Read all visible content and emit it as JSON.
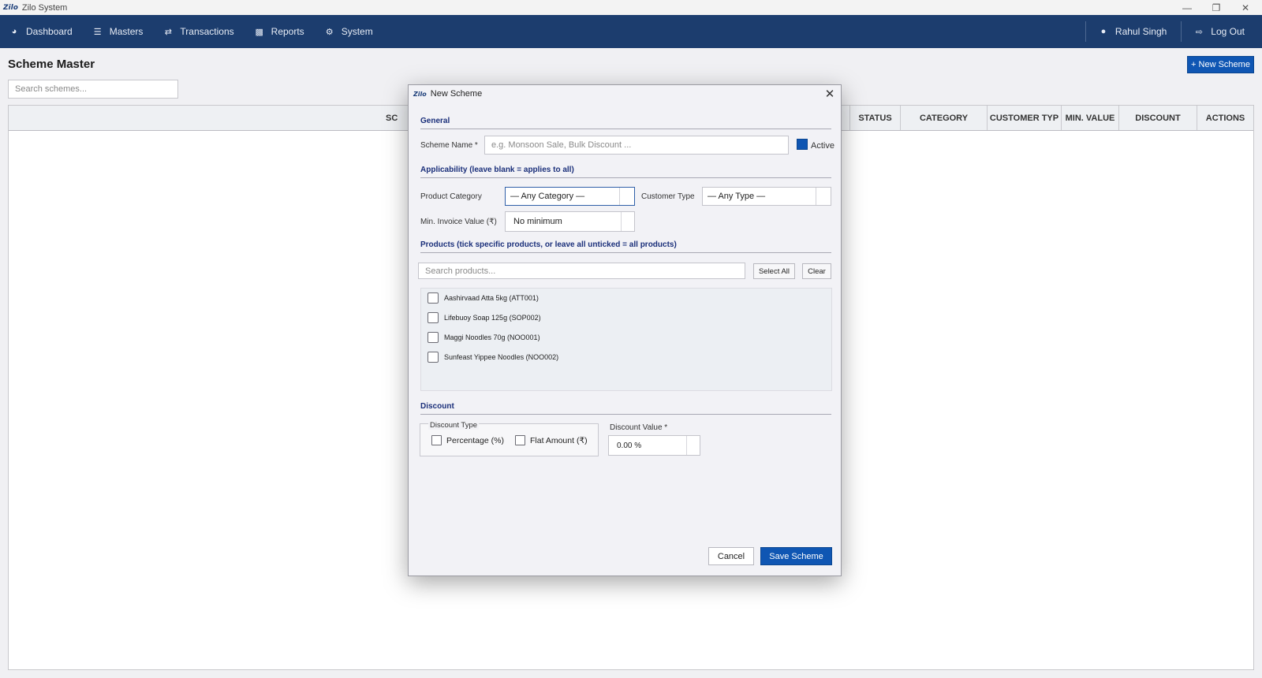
{
  "window": {
    "logo": "Zilo",
    "title": "Zilo System",
    "minimize_icon": "minimize-icon",
    "restore_icon": "restore-icon",
    "close_icon": "close-icon"
  },
  "nav": {
    "items": [
      {
        "label": "Dashboard",
        "icon": "dashboard-icon"
      },
      {
        "label": "Masters",
        "icon": "database-icon"
      },
      {
        "label": "Transactions",
        "icon": "swap-arrows-icon"
      },
      {
        "label": "Reports",
        "icon": "bar-chart-icon"
      },
      {
        "label": "System",
        "icon": "gear-icon"
      }
    ],
    "user": "Rahul Singh",
    "logout": "Log Out"
  },
  "page": {
    "title": "Scheme Master",
    "new_button": "+ New Scheme",
    "search_placeholder": "Search schemes..."
  },
  "table": {
    "columns": [
      "SC",
      "STATUS",
      "CATEGORY",
      "CUSTOMER TYP",
      "MIN. VALUE",
      "DISCOUNT",
      "ACTIONS"
    ]
  },
  "dialog": {
    "logo": "Zilo",
    "title": "New Scheme",
    "general": {
      "section": "General",
      "name_label": "Scheme Name *",
      "name_placeholder": "e.g. Monsoon Sale, Bulk Discount ...",
      "active_label": "Active",
      "active_checked": true
    },
    "applicability": {
      "section": "Applicability  (leave blank = applies to all)",
      "category_label": "Product Category",
      "category_value": "— Any Category —",
      "customer_label": "Customer Type",
      "customer_value": "— Any Type —",
      "min_label": "Min. Invoice Value (₹)",
      "min_value": "No minimum"
    },
    "products": {
      "section": "Products  (tick specific products, or leave all unticked = all products)",
      "search_placeholder": "Search products...",
      "select_all": "Select All",
      "clear": "Clear",
      "items": [
        "Aashirvaad Atta 5kg  (ATT001)",
        "Lifebuoy Soap 125g  (SOP002)",
        "Maggi Noodles 70g  (NOO001)",
        "Sunfeast Yippee Noodles  (NOO002)"
      ]
    },
    "discount": {
      "section": "Discount",
      "type_label": "Discount Type",
      "percentage": "Percentage (%)",
      "flat": "Flat Amount (₹)",
      "value_label": "Discount Value *",
      "value": "0.00 %"
    },
    "cancel": "Cancel",
    "save": "Save Scheme"
  },
  "colors": {
    "nav_bg": "#1c3d6e",
    "accent": "#0f56b3",
    "section_text": "#1a2f7a"
  }
}
